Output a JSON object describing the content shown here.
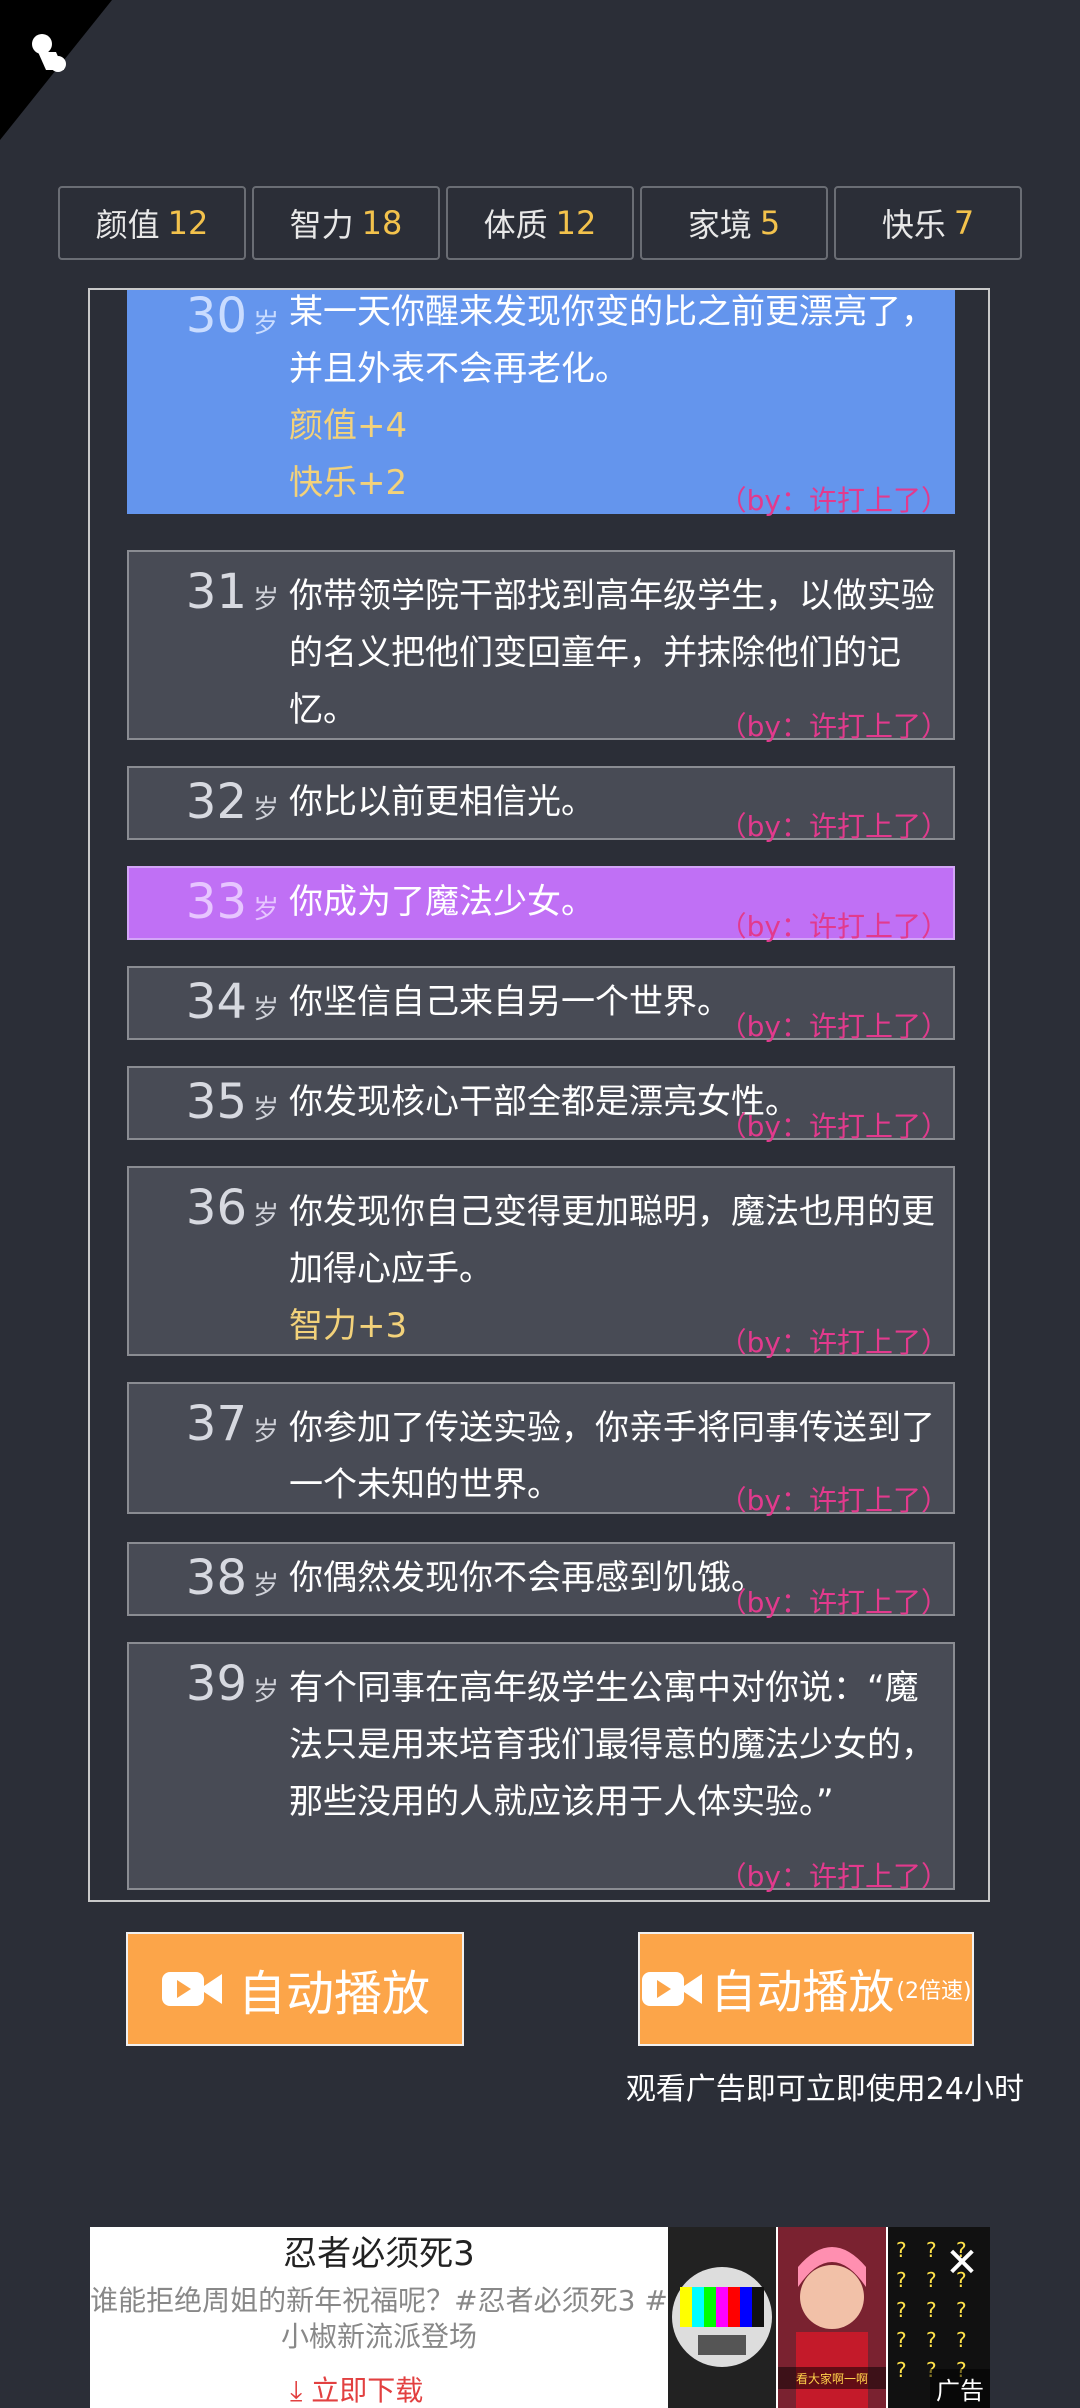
{
  "stats": [
    {
      "label": "颜值",
      "value": "12"
    },
    {
      "label": "智力",
      "value": "18"
    },
    {
      "label": "体质",
      "value": "12"
    },
    {
      "label": "家境",
      "value": "5"
    },
    {
      "label": "快乐",
      "value": "7"
    }
  ],
  "age_unit": "岁",
  "author": "（by：许打上了）",
  "events": [
    {
      "age": "30",
      "lines": [
        "某一天你醒来发现你变的比之前更漂亮了，并且外表不会再老化。"
      ],
      "effects": [
        "颜值+4",
        "快乐+2"
      ]
    },
    {
      "age": "31",
      "lines": [
        "你带领学院干部找到高年级学生，以做实验的名义把他们变回童年，并抹除他们的记忆。"
      ],
      "effects": []
    },
    {
      "age": "32",
      "lines": [
        "你比以前更相信光。"
      ],
      "effects": []
    },
    {
      "age": "33",
      "lines": [
        "你成为了魔法少女。"
      ],
      "effects": []
    },
    {
      "age": "34",
      "lines": [
        "你坚信自己来自另一个世界。"
      ],
      "effects": []
    },
    {
      "age": "35",
      "lines": [
        "你发现核心干部全都是漂亮女性。"
      ],
      "effects": []
    },
    {
      "age": "36",
      "lines": [
        "你发现你自己变得更加聪明，魔法也用的更加得心应手。"
      ],
      "effects": [
        "智力+3"
      ]
    },
    {
      "age": "37",
      "lines": [
        "你参加了传送实验，你亲手将同事传送到了一个未知的世界。"
      ],
      "effects": []
    },
    {
      "age": "38",
      "lines": [
        "你偶然发现你不会再感到饥饿。"
      ],
      "effects": []
    },
    {
      "age": "39",
      "lines": [
        "有个同事在高年级学生公寓中对你说：“魔法只是用来培育我们最得意的魔法少女的，那些没用的人就应该用于人体实验。”"
      ],
      "effects": []
    }
  ],
  "buttons": {
    "autoplay": "自动播放",
    "autoplay_fast": "自动播放",
    "autoplay_fast_suffix": "(2倍速)",
    "note": "观看广告即可立即使用24小时"
  },
  "ad": {
    "title": "忍者必须死3",
    "desc": "谁能拒绝周姐的新年祝福呢？#忍者必须死3 #小椒新流派登场",
    "download": "立即下载",
    "badge": "广告",
    "caption": "看大家啊一啊"
  },
  "colors": {
    "accent": "#f3c24c",
    "button": "#fca549",
    "blue_event": "#6495ed",
    "purple_event": "#c070f5",
    "author": "#e23a8d"
  }
}
